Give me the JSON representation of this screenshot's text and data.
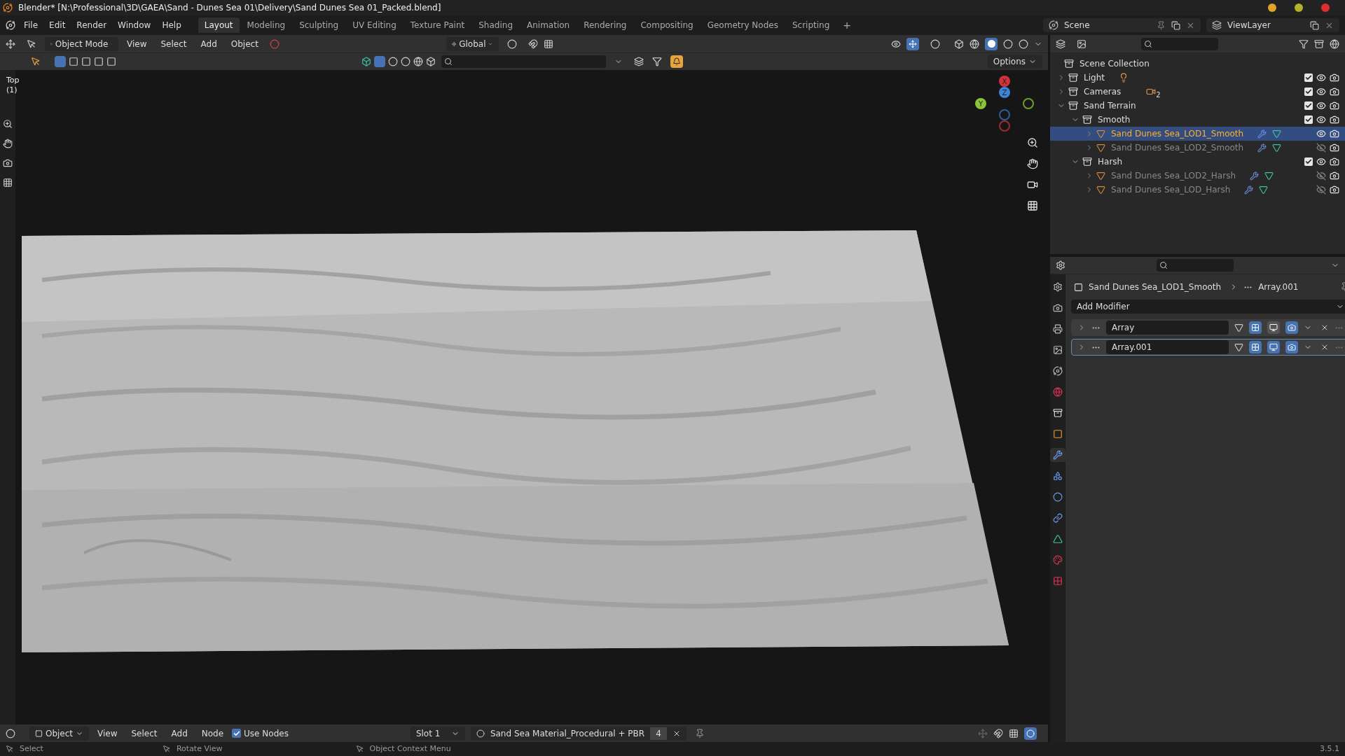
{
  "window": {
    "title": "Blender* [N:\\Professional\\3D\\GAEA\\Sand - Dunes Sea 01\\Delivery\\Sand Dunes Sea 01_Packed.blend]"
  },
  "menu": [
    "File",
    "Edit",
    "Render",
    "Window",
    "Help"
  ],
  "workspaces": [
    {
      "label": "Layout",
      "selected": true
    },
    {
      "label": "Modeling",
      "selected": false
    },
    {
      "label": "Sculpting",
      "selected": false
    },
    {
      "label": "UV Editing",
      "selected": false
    },
    {
      "label": "Texture Paint",
      "selected": false
    },
    {
      "label": "Shading",
      "selected": false
    },
    {
      "label": "Animation",
      "selected": false
    },
    {
      "label": "Rendering",
      "selected": false
    },
    {
      "label": "Compositing",
      "selected": false
    },
    {
      "label": "Geometry Nodes",
      "selected": false
    },
    {
      "label": "Scripting",
      "selected": false
    }
  ],
  "add_workspace": "+",
  "scene": "Scene",
  "view_layer": "ViewLayer",
  "viewport": {
    "mode": "Object Mode",
    "menus": [
      "View",
      "Select",
      "Add",
      "Object"
    ],
    "orientation": "Global",
    "options": "Options",
    "view_name": "Top",
    "frame": "(1)",
    "axes": [
      "X",
      "Y",
      "Z"
    ]
  },
  "outliner": {
    "root": "Scene Collection",
    "items": [
      {
        "name": "Light",
        "kind": "collection",
        "expanded": false,
        "checked": true,
        "visible": true,
        "selected": false,
        "contents": [
          {
            "kind": "light"
          }
        ]
      },
      {
        "name": "Cameras",
        "kind": "collection",
        "expanded": false,
        "checked": true,
        "visible": true,
        "selected": false,
        "contents": [
          {
            "kind": "camera",
            "count": "2"
          }
        ]
      },
      {
        "name": "Sand Terrain",
        "kind": "collection",
        "expanded": true,
        "checked": true,
        "visible": true,
        "selected": false,
        "children": [
          {
            "name": "Smooth",
            "kind": "collection",
            "expanded": true,
            "checked": true,
            "visible": true,
            "selected": false,
            "children": [
              {
                "name": "Sand Dunes Sea_LOD1_Smooth",
                "kind": "mesh",
                "expanded": false,
                "visible": true,
                "selected": true
              },
              {
                "name": "Sand Dunes Sea_LOD2_Smooth",
                "kind": "mesh",
                "expanded": false,
                "visible": false,
                "selected": false
              }
            ]
          },
          {
            "name": "Harsh",
            "kind": "collection",
            "expanded": true,
            "checked": true,
            "visible": true,
            "selected": false,
            "children": [
              {
                "name": "Sand Dunes Sea_LOD2_Harsh",
                "kind": "mesh",
                "expanded": false,
                "visible": false,
                "selected": false
              },
              {
                "name": "Sand Dunes Sea_LOD_Harsh",
                "kind": "mesh",
                "expanded": false,
                "visible": false,
                "selected": false
              }
            ]
          }
        ]
      }
    ]
  },
  "properties": {
    "object": "Sand Dunes Sea_LOD1_Smooth",
    "modifier": "Array.001",
    "add_modifier": "Add Modifier",
    "tabs": [
      {
        "kind": "tool",
        "selected": false
      },
      {
        "kind": "render",
        "selected": false
      },
      {
        "kind": "output",
        "selected": false
      },
      {
        "kind": "view_layer",
        "selected": false
      },
      {
        "kind": "scene",
        "selected": false
      },
      {
        "kind": "world",
        "selected": false
      },
      {
        "kind": "collection",
        "selected": false
      },
      {
        "kind": "object",
        "selected": false
      },
      {
        "kind": "modifiers",
        "selected": true
      },
      {
        "kind": "particles",
        "selected": false
      },
      {
        "kind": "physics",
        "selected": false
      },
      {
        "kind": "constraints",
        "selected": false
      },
      {
        "kind": "data",
        "selected": false
      },
      {
        "kind": "material",
        "selected": false
      },
      {
        "kind": "texture",
        "selected": false
      }
    ],
    "modifiers": [
      {
        "name": "Array",
        "selected": false,
        "show_viewport": false
      },
      {
        "name": "Array.001",
        "selected": true,
        "show_viewport": true
      }
    ]
  },
  "shader_header": {
    "mode": "Object",
    "menus": [
      "View",
      "Select",
      "Add",
      "Node"
    ],
    "use_nodes": {
      "label": "Use Nodes",
      "checked": true
    },
    "slot": "Slot 1",
    "material": "Sand Sea Material_Procedural + PBR",
    "users": "4"
  },
  "status_bar": {
    "hints": [
      "Select",
      "Rotate View",
      "Object Context Menu"
    ],
    "version": "3.5.1"
  }
}
